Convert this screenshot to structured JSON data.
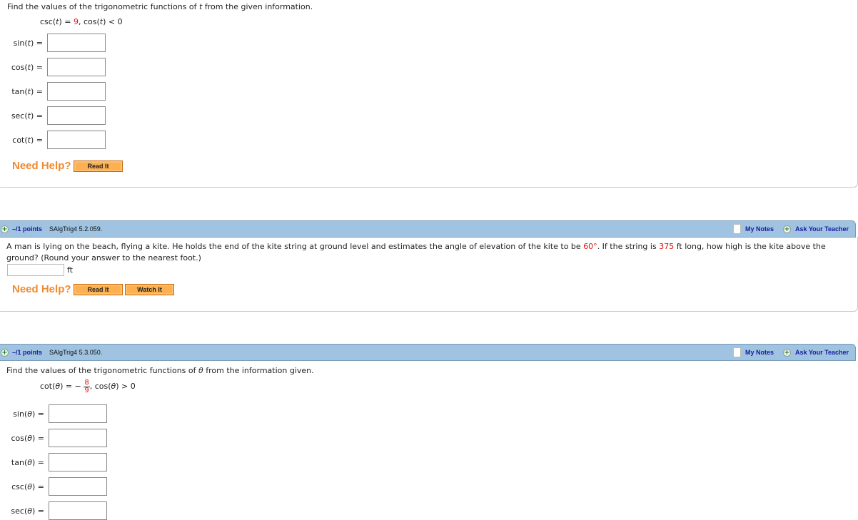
{
  "q1": {
    "prompt": "Find the values of the trigonometric functions of",
    "var": "t",
    "prompt_end": "from the given information.",
    "given": {
      "f1": "csc(",
      "v1": "t",
      "f1b": ") = ",
      "val1": "9",
      "sep": ",  cos(",
      "v2": "t",
      "f2b": ") < 0"
    },
    "fields": [
      {
        "fn": "sin(",
        "var": "t",
        "end": ")  ="
      },
      {
        "fn": "cos(",
        "var": "t",
        "end": ")  ="
      },
      {
        "fn": "tan(",
        "var": "t",
        "end": ")  ="
      },
      {
        "fn": "sec(",
        "var": "t",
        "end": ")  ="
      },
      {
        "fn": "cot(",
        "var": "t",
        "end": ")  ="
      }
    ],
    "need_help": "Need Help?",
    "read_it": "Read It"
  },
  "q2": {
    "header": {
      "points": "–/1 points",
      "code": "SAlgTrig4 5.2.059.",
      "my_notes": "My Notes",
      "ask_teacher": "Ask Your Teacher"
    },
    "text_a": "A man is lying on the beach, flying a kite. He holds the end of the kite string at ground level and estimates the angle of elevation of the kite to be ",
    "angle": "60°",
    "text_b": ". If the string is ",
    "length": "375",
    "text_c": " ft long, how high is the kite above the",
    "text_d": "ground? (Round your answer to the nearest foot.)",
    "answer_value": "",
    "unit": "ft",
    "need_help": "Need Help?",
    "read_it": "Read It",
    "watch_it": "Watch It"
  },
  "q3": {
    "header": {
      "points": "–/1 points",
      "code": "SAlgTrig4 5.3.050.",
      "my_notes": "My Notes",
      "ask_teacher": "Ask Your Teacher"
    },
    "prompt": "Find the values of the trigonometric functions of",
    "var": "θ",
    "prompt_end": "from the information given.",
    "given": {
      "f1": "cot(",
      "v1": "θ",
      "f1b": ") = −",
      "num": "8",
      "den": "9",
      "sep": ",  cos(",
      "v2": "θ",
      "f2b": ") > 0"
    },
    "fields": [
      {
        "fn": "sin(",
        "var": "θ",
        "end": ")  ="
      },
      {
        "fn": "cos(",
        "var": "θ",
        "end": ")  ="
      },
      {
        "fn": "tan(",
        "var": "θ",
        "end": ")  ="
      },
      {
        "fn": "csc(",
        "var": "θ",
        "end": ")  ="
      },
      {
        "fn": "sec(",
        "var": "θ",
        "end": ")  ="
      }
    ]
  }
}
